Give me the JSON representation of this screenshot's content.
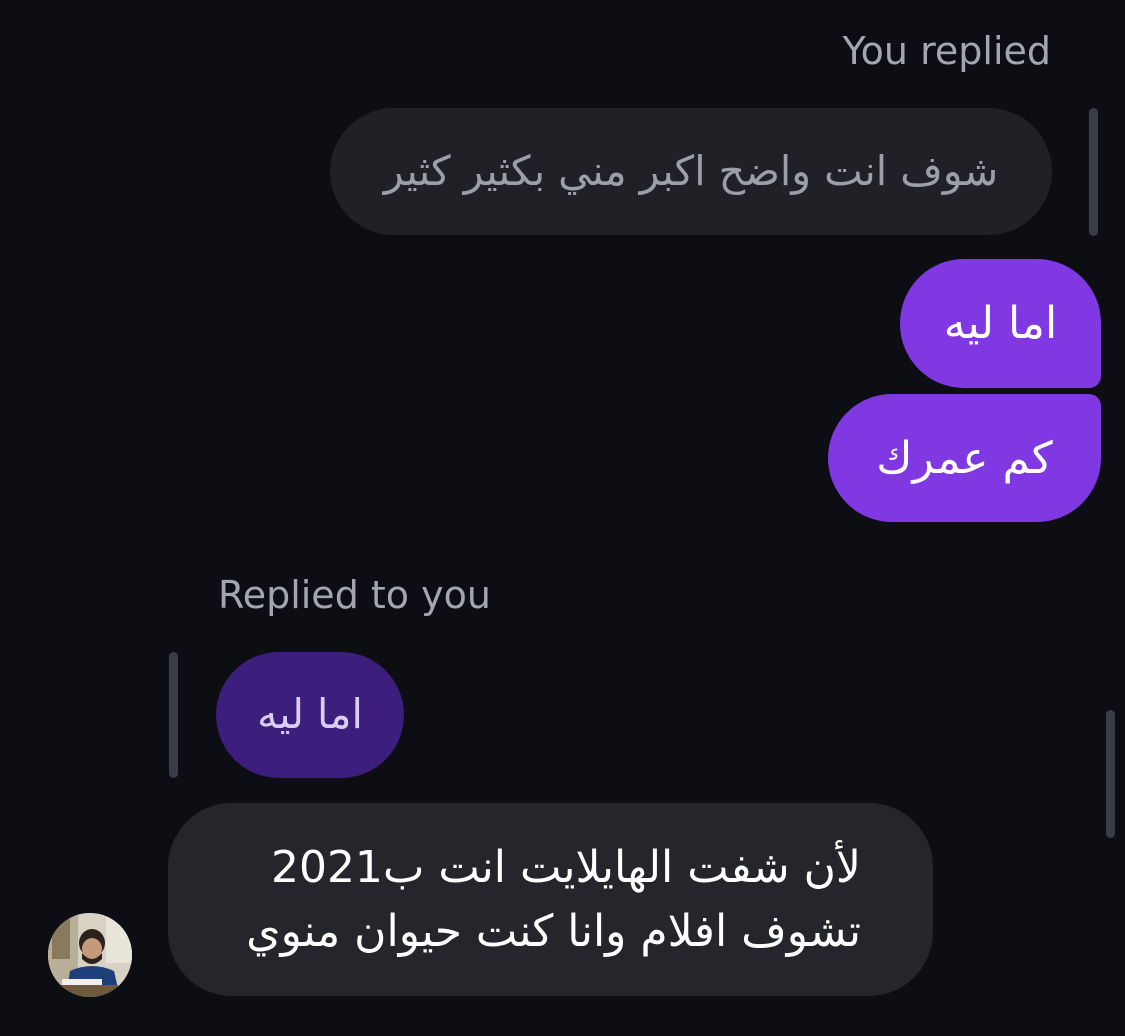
{
  "outgoing_section": {
    "context_label": "You replied",
    "quoted_message": "شوف انت واضح اكبر مني بكثير كثير",
    "messages": [
      {
        "text": "اما ليه"
      },
      {
        "text": "كم عمرك"
      }
    ]
  },
  "incoming_section": {
    "context_label": "Replied to you",
    "quoted_message": "اما ليه",
    "message_lines": [
      "لأن شفت الهايلايت انت ب2021",
      "تشوف افلام وانا كنت حيوان منوي"
    ]
  },
  "colors": {
    "background": "#0c0e13",
    "sent_bubble": "#8038e3",
    "quoted_incoming": "#3c1e7c",
    "received_bubble": "#24262c",
    "quoted_outgoing": "#1f2126"
  },
  "icons": {
    "avatar": "sender-avatar-photo"
  }
}
